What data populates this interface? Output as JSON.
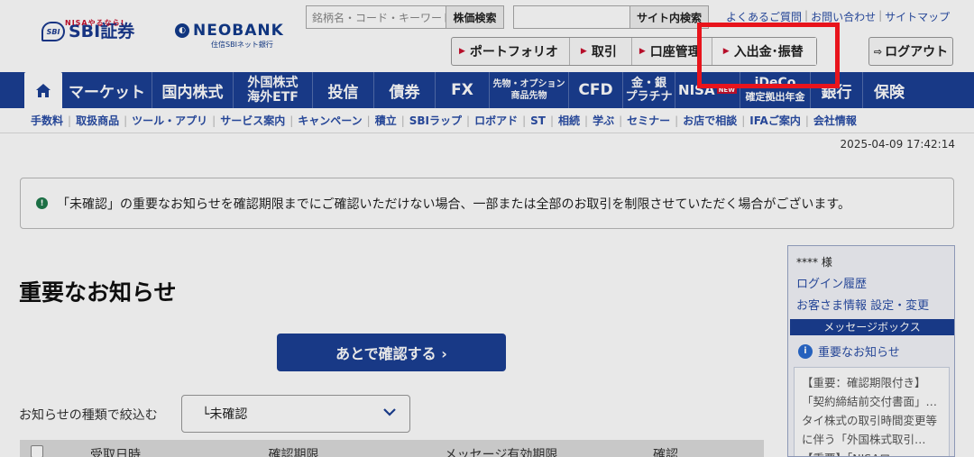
{
  "header": {
    "brand_sbi": "SBI証券",
    "brand_sbi_tagline": "NISAやるなら!",
    "brand_sbi_mark": "SBI",
    "brand_neo": "NEOBANK",
    "brand_neo_sub": "住信SBIネット銀行",
    "stock_search_placeholder": "銘柄名・コード・キーワード",
    "stock_search_button": "株価検索",
    "site_search_placeholder": "",
    "site_search_button": "サイト内検索",
    "top_links": [
      "よくあるご質問",
      "お問い合わせ",
      "サイトマップ"
    ],
    "quick_buttons": [
      "ポートフォリオ",
      "取引",
      "口座管理",
      "入出金･振替"
    ],
    "logout_label": "ログアウト"
  },
  "main_nav": {
    "items": [
      "マーケット",
      "国内株式",
      "外国株式",
      "海外ETF",
      "投信",
      "債券",
      "FX",
      "先物・オプション",
      "商品先物",
      "CFD",
      "金・銀",
      "プラチナ",
      "NISA",
      "NEW",
      "iDeCo",
      "確定拠出年金",
      "銀行",
      "保険"
    ]
  },
  "sub_nav": {
    "items": [
      "手数料",
      "取扱商品",
      "ツール・アプリ",
      "サービス案内",
      "キャンペーン",
      "積立",
      "SBIラップ",
      "ロボアド",
      "ST",
      "相続",
      "学ぶ",
      "セミナー",
      "お店で相談",
      "IFAご案内",
      "会社情報"
    ]
  },
  "datetime": "2025-04-09 17:42:14",
  "notice": {
    "text": "「未確認」の重要なお知らせを確認期限までにご確認いただけない場合、一部または全部のお取引を制限させていただく場合がございます。"
  },
  "page": {
    "title": "重要なお知らせ",
    "later_button": "あとで確認する ›",
    "filter_label": "お知らせの種類で絞込む",
    "filter_value": "└未確認",
    "table_headers": [
      "受取日時",
      "確認期限",
      "メッセージ有効期限",
      "確認"
    ]
  },
  "sidebar": {
    "user_name": "**** 様",
    "links": [
      "ログイン履歴",
      "お客さま情報 設定・変更"
    ],
    "message_box_title": "メッセージボックス",
    "important_link": "重要なお知らせ",
    "messages": [
      "【重要：確認期限付き】",
      "「契約締結前交付書面」…",
      "タイ株式の取引時間変更等",
      "に伴う「外国株式取引…",
      "【重要】「NISAロ…"
    ]
  },
  "colors": {
    "nav_blue": "#1b3f94",
    "link_blue": "#2a4ea6",
    "highlight_red": "#e8141c",
    "accent_red": "#c8102e"
  }
}
